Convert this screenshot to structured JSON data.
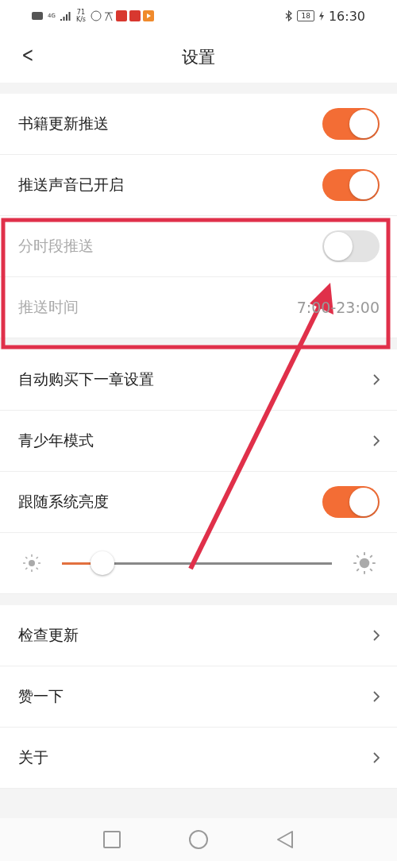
{
  "status_bar": {
    "network": "4G",
    "speed_value": "71",
    "speed_unit": "K/s",
    "battery": "18",
    "time": "16:30"
  },
  "header": {
    "back": "<",
    "title": "设置"
  },
  "groups": [
    {
      "rows": [
        {
          "kind": "toggle",
          "label": "书籍更新推送",
          "on": true,
          "disabled": false
        },
        {
          "kind": "toggle",
          "label": "推送声音已开启",
          "on": true,
          "disabled": false
        },
        {
          "kind": "toggle",
          "label": "分时段推送",
          "on": false,
          "disabled": true
        },
        {
          "kind": "value",
          "label": "推送时间",
          "value": "7:00-23:00",
          "disabled": true
        }
      ]
    },
    {
      "rows": [
        {
          "kind": "link",
          "label": "自动购买下一章设置"
        },
        {
          "kind": "link",
          "label": "青少年模式"
        },
        {
          "kind": "toggle",
          "label": "跟随系统亮度",
          "on": true,
          "disabled": false
        },
        {
          "kind": "slider",
          "level": 0.15
        }
      ]
    },
    {
      "rows": [
        {
          "kind": "link",
          "label": "检查更新"
        },
        {
          "kind": "link",
          "label": "赞一下"
        },
        {
          "kind": "link",
          "label": "关于"
        }
      ]
    }
  ]
}
